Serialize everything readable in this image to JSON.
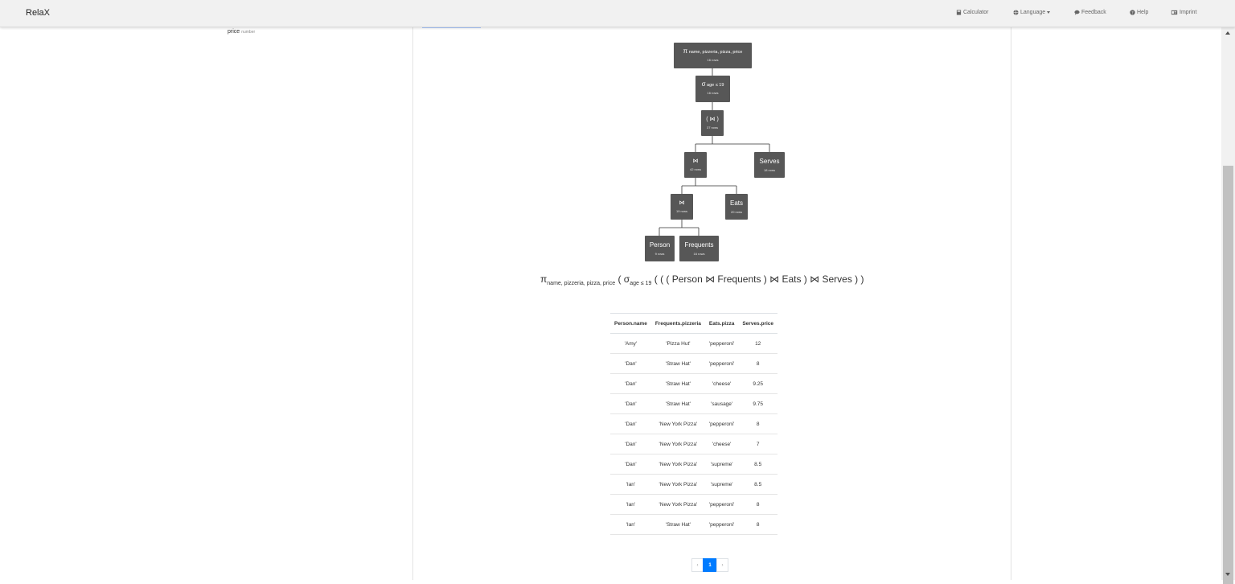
{
  "navbar": {
    "brand": "RelaX",
    "items": [
      {
        "label": "Calculator",
        "icon": "calculator-icon"
      },
      {
        "label": "Language",
        "icon": "globe-icon"
      },
      {
        "label": "Feedback",
        "icon": "comment-icon"
      },
      {
        "label": "Help",
        "icon": "question-circle-icon"
      },
      {
        "label": "Imprint",
        "icon": "id-card-icon"
      }
    ]
  },
  "left_panel": {
    "attribute_name": "price",
    "attribute_type": "number"
  },
  "tree": {
    "projection": {
      "symbol": "π",
      "attrs": "name, pizzeria, pizza, price",
      "rows": "16 rows"
    },
    "selection": {
      "symbol": "σ",
      "cond": "age ≤ 19",
      "rows": "16 rows"
    },
    "join_outer": {
      "label": "( ⋈ )",
      "rows": "37 rows"
    },
    "join_mid": {
      "label": "⋈",
      "rows": "42 rows"
    },
    "serves": {
      "label": "Serves",
      "rows": "18 rows"
    },
    "join_inner": {
      "label": "⋈",
      "rows": "19 rows"
    },
    "eats": {
      "label": "Eats",
      "rows": "20 rows"
    },
    "person": {
      "label": "Person",
      "rows": "9 rows"
    },
    "frequents": {
      "label": "Frequents",
      "rows": "16 rows"
    }
  },
  "expression": {
    "pi": "π",
    "pi_sub": "name, pizzeria, pizza, price",
    "open": "(",
    "sigma": "σ",
    "sigma_sub": "age ≤ 19",
    "rest": "( ( ( Person ⋈ Frequents ) ⋈ Eats ) ⋈ Serves ) )"
  },
  "result_table": {
    "columns": [
      "Person.name",
      "Frequents.pizzeria",
      "Eats.pizza",
      "Serves.price"
    ],
    "rows": [
      [
        "'Amy'",
        "'Pizza Hut'",
        "'pepperoni'",
        "12"
      ],
      [
        "'Dan'",
        "'Straw Hat'",
        "'pepperoni'",
        "8"
      ],
      [
        "'Dan'",
        "'Straw Hat'",
        "'cheese'",
        "9.25"
      ],
      [
        "'Dan'",
        "'Straw Hat'",
        "'sausage'",
        "9.75"
      ],
      [
        "'Dan'",
        "'New York Pizza'",
        "'pepperoni'",
        "8"
      ],
      [
        "'Dan'",
        "'New York Pizza'",
        "'cheese'",
        "7"
      ],
      [
        "'Dan'",
        "'New York Pizza'",
        "'supreme'",
        "8.5"
      ],
      [
        "'Ian'",
        "'New York Pizza'",
        "'supreme'",
        "8.5"
      ],
      [
        "'Ian'",
        "'New York Pizza'",
        "'pepperoni'",
        "8"
      ],
      [
        "'Ian'",
        "'Straw Hat'",
        "'pepperoni'",
        "8"
      ]
    ]
  },
  "pagination": {
    "prev": "‹",
    "current": "1",
    "next": "›"
  },
  "colors": {
    "node_bg": "#575757",
    "accent": "#007bff"
  }
}
